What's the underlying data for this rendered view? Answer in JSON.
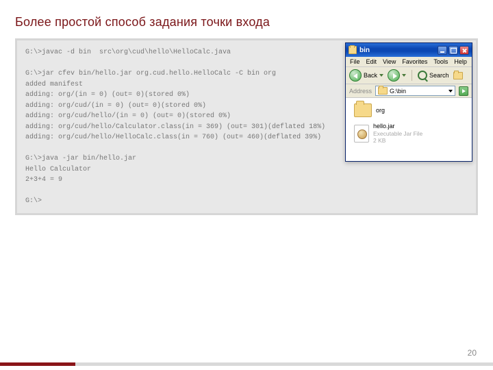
{
  "title": "Более простой способ задания точки входа",
  "code": "G:\\>javac -d bin  src\\org\\cud\\hello\\HelloCalc.java\n\nG:\\>jar cfev bin/hello.jar org.cud.hello.HelloCalc -C bin org\nadded manifest\nadding: org/(in = 0) (out= 0)(stored 0%)\nadding: org/cud/(in = 0) (out= 0)(stored 0%)\nadding: org/cud/hello/(in = 0) (out= 0)(stored 0%)\nadding: org/cud/hello/Calculator.class(in = 369) (out= 301)(deflated 18%)\nadding: org/cud/hello/HelloCalc.class(in = 760) (out= 460)(deflated 39%)\n\nG:\\>java -jar bin/hello.jar\nHello Calculator\n2+3+4 = 9\n\nG:\\>",
  "explorer": {
    "title": "bin",
    "menu": [
      "File",
      "Edit",
      "View",
      "Favorites",
      "Tools",
      "Help"
    ],
    "back": "Back",
    "search": "Search",
    "addressLabel": "Address",
    "addressValue": "G:\\bin",
    "items": [
      {
        "type": "folder",
        "name": "org",
        "meta": ""
      },
      {
        "type": "jar",
        "name": "hello.jar",
        "meta": "Executable Jar File\n2 KB"
      }
    ]
  },
  "pageNumber": "20"
}
